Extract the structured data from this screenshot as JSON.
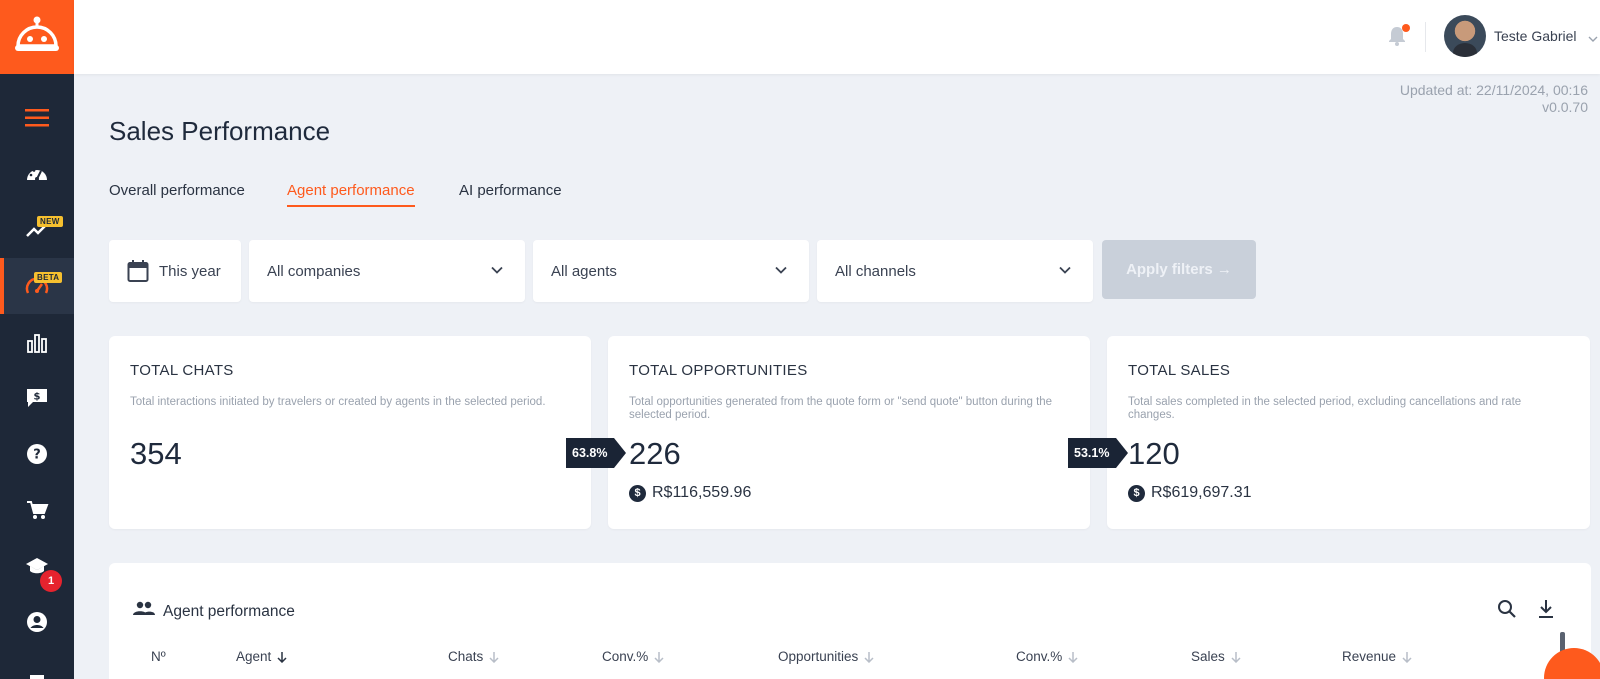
{
  "user": {
    "name": "Teste Gabriel"
  },
  "meta": {
    "updated": "Updated at: 22/11/2024, 00:16",
    "version": "v0.0.70"
  },
  "page": {
    "title": "Sales Performance"
  },
  "tabs": [
    {
      "label": "Overall performance",
      "active": false
    },
    {
      "label": "Agent performance",
      "active": true
    },
    {
      "label": "AI performance",
      "active": false
    }
  ],
  "filters": {
    "period": "This year",
    "companies": "All companies",
    "agents": "All agents",
    "channels": "All channels",
    "apply": "Apply filters →"
  },
  "sidebar": {
    "badges": {
      "new": "NEW",
      "beta": "BETA",
      "courses_count": "1"
    }
  },
  "cards": [
    {
      "title": "TOTAL CHATS",
      "description": "Total interactions initiated by travelers or created by agents in the selected period.",
      "value": "354"
    },
    {
      "title": "TOTAL OPPORTUNITIES",
      "description": "Total opportunities generated from the quote form or \"send quote\" button during the selected period.",
      "value": "226",
      "money": "R$116,559.96",
      "conversion": "63.8%"
    },
    {
      "title": "TOTAL SALES",
      "description": "Total sales completed in the selected period, excluding cancellations and rate changes.",
      "value": "120",
      "money": "R$619,697.31",
      "conversion": "53.1%"
    }
  ],
  "table": {
    "title": "Agent performance",
    "columns": [
      "Nº",
      "Agent",
      "Chats",
      "Conv.%",
      "Opportunities",
      "Conv.%",
      "Sales",
      "Revenue"
    ]
  },
  "colors": {
    "brand": "#fe5a1d",
    "sidebar": "#1e2838",
    "dark_tag": "#1a2435"
  }
}
